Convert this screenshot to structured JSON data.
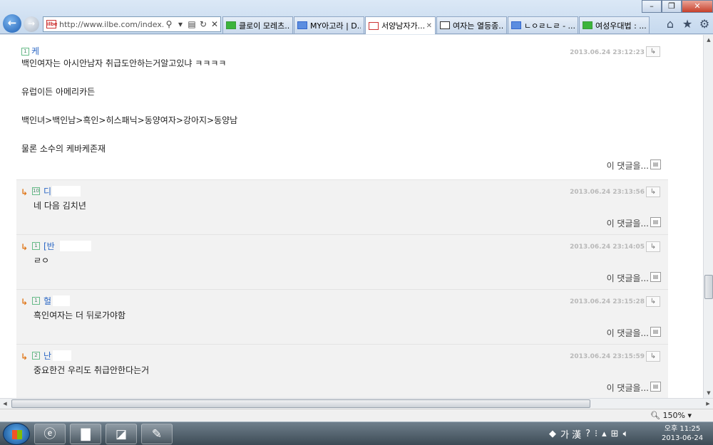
{
  "browser": {
    "address": "http://www.ilbe.com/index.ph",
    "tabs": [
      {
        "label": "클로이 모레츠...",
        "icon": "green"
      },
      {
        "label": "MY아고라 | D...",
        "icon": "blue"
      },
      {
        "label": "서양남자가...",
        "icon": "red",
        "active": true
      },
      {
        "label": "여자는 열등종...",
        "icon": "dc"
      },
      {
        "label": "ㄴㅇㄹㄴㄹ - ...",
        "icon": "blue"
      },
      {
        "label": "여성우대법 : ...",
        "icon": "green"
      }
    ],
    "zoom": "150%"
  },
  "comments": [
    {
      "level": "1",
      "name": "케",
      "date": "2013.06.24 23:12:23",
      "lines": [
        "백인여자는 아시안남자 취급도안하는거알고있냐 ㅋㅋㅋㅋ",
        "",
        "유럽이든 아메리카든",
        "",
        "백인녀>백인남>흑인>히스패닉>동양여자>강아지>동양남",
        "",
        "물론 소수의 케바케존재"
      ],
      "more": "이 댓글을..."
    },
    {
      "level": "10",
      "name": "디",
      "date": "2013.06.24 23:13:56",
      "lines": [
        "네 다음 김치년"
      ],
      "more": "이 댓글을..."
    },
    {
      "level": "1",
      "name": "[반",
      "date": "2013.06.24 23:14:05",
      "lines": [
        "ㄹㅇ"
      ],
      "more": "이 댓글을..."
    },
    {
      "level": "1",
      "name": "헐",
      "date": "2013.06.24 23:15:28",
      "lines": [
        "흑인여자는 더 뒤로가야함"
      ],
      "more": "이 댓글을..."
    },
    {
      "level": "2",
      "name": "난",
      "date": "2013.06.24 23:15:59",
      "lines": [
        "중요한건 우리도 취급안한다는거"
      ],
      "more": "이 댓글을..."
    }
  ],
  "taskbar": {
    "ime": "가 漢",
    "time": "오후 11:25",
    "date": "2013-06-24"
  }
}
